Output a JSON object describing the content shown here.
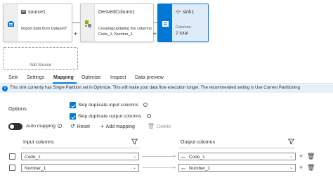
{
  "flow": {
    "nodes": [
      {
        "name": "source1",
        "description_lines": [
          "Import data from Dataset?"
        ]
      },
      {
        "name": "DerivedColumn1",
        "description_lines": [
          "Creating/updating the columns",
          "Code_1, Number_1"
        ]
      },
      {
        "name": "sink1",
        "sub_label": "Columns:",
        "sub_value": "2 total"
      }
    ],
    "plus_glyph": "+",
    "add_source_label": "Add Source"
  },
  "tabs": [
    {
      "label": "Sink",
      "active": false
    },
    {
      "label": "Settings",
      "active": false
    },
    {
      "label": "Mapping",
      "active": true
    },
    {
      "label": "Optimize",
      "active": false
    },
    {
      "label": "Inspect",
      "active": false
    },
    {
      "label": "Data preview",
      "active": false
    }
  ],
  "info_bar": {
    "icon": "info-icon",
    "text": "This sink currently has Single Partition set in Optimize. This will make your data flow execution longer. The recommended setting is Use Current Partitioning"
  },
  "options": {
    "label": "Options",
    "skip_input_label": "Skip duplicate input columns",
    "skip_input_checked": true,
    "skip_output_label": "Skip duplicate output columns",
    "skip_output_checked": true,
    "auto_mapping_label": "Auto mapping",
    "auto_mapping_on": false,
    "reset_label": "Reset",
    "add_mapping_label": "Add mapping",
    "delete_label": "Delete"
  },
  "mapping": {
    "input_header": "Input columns",
    "output_header": "Output columns",
    "type_badge": "abc",
    "rows": [
      {
        "input": "Code_1",
        "output": "Code_1"
      },
      {
        "input": "Number_1",
        "output": "Number_1"
      }
    ]
  },
  "colors": {
    "accent": "#0078d4",
    "selected_node_bg": "#deecf9",
    "info_bg": "#e7f0fa"
  }
}
